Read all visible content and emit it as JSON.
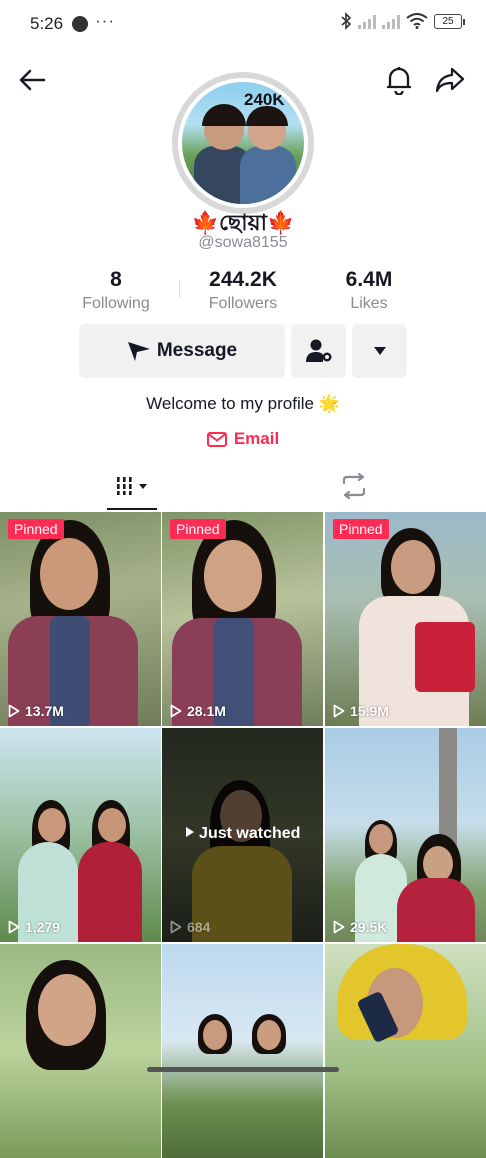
{
  "status": {
    "time": "5:26",
    "dots": "···",
    "battery": "25"
  },
  "profile": {
    "avatar_badge": "240K",
    "display_name": "🍁ছোয়া🍁",
    "username": "@sowa8155",
    "stats": [
      {
        "value": "8",
        "label": "Following"
      },
      {
        "value": "244.2K",
        "label": "Followers"
      },
      {
        "value": "6.4M",
        "label": "Likes"
      }
    ],
    "message_label": "Message",
    "bio": "Welcome to my profile 🌟",
    "email_label": "Email"
  },
  "grid": {
    "pinned_label": "Pinned",
    "just_watched_label": "Just watched",
    "videos": [
      {
        "views": "13.7M",
        "pinned": true
      },
      {
        "views": "28.1M",
        "pinned": true
      },
      {
        "views": "15.9M",
        "pinned": true
      },
      {
        "views": "1,279",
        "pinned": false
      },
      {
        "views": "684",
        "pinned": false,
        "just_watched": true
      },
      {
        "views": "29.5K",
        "pinned": false
      },
      {
        "views": "",
        "pinned": false
      },
      {
        "views": "",
        "pinned": false
      },
      {
        "views": "",
        "pinned": false
      }
    ]
  },
  "colors": {
    "accent": "#fe2c55",
    "text": "#161823",
    "muted": "#8a8b91",
    "button_bg": "#f1f1f2"
  },
  "icons": [
    "back-arrow-icon",
    "bell-icon",
    "share-icon",
    "send-icon",
    "add-friend-icon",
    "chevron-down-icon",
    "mail-icon",
    "grid-icon",
    "repost-icon",
    "play-icon"
  ]
}
